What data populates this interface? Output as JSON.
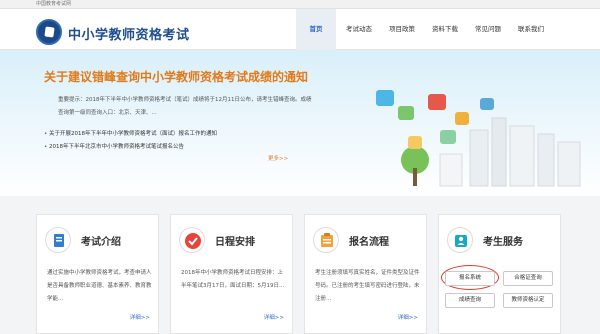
{
  "topbar": {
    "text": "中国教育考试网"
  },
  "header": {
    "site_title": "中小学教师资格考试",
    "nav": [
      "首页",
      "考试动态",
      "项目政策",
      "资料下载",
      "常见问题",
      "联系我们"
    ],
    "active_nav": "首页"
  },
  "banner": {
    "heading": "关于建议错峰查询中小学教师资格考试成绩的通知",
    "summary": "重要提示：2018年下半年中小学教师资格考试（笔试）成绩将于12月11日公布，请考生错峰查询。成绩查询第一级同查询入口：北京、天津、...",
    "links": [
      "关于开展2018年下半年中小学教师资格考试（面试）报名工作的通知",
      "2018年下半年北京市中小学教师资格考试笔试报名公告"
    ],
    "more": "更多>>"
  },
  "cards": [
    {
      "title": "考试介绍",
      "body": "通过实施中小学教师资格考试，考查申请人是否具备教师职业道德、基本素养、教育教学能...",
      "detail": "详细>>",
      "icon": "pen-document-icon"
    },
    {
      "title": "日程安排",
      "body": "2018年中小学教师资格考试日程安排：上半年笔试3月17日，面试日期：5月19日...",
      "detail": "详细>>",
      "icon": "check-circle-icon"
    },
    {
      "title": "报名流程",
      "body": "考生注册须填写真实姓名，证件类型及证件号码。已注册的考生填写密码进行登陆，未注册...",
      "detail": "详细>>",
      "icon": "clipboard-icon"
    },
    {
      "title": "考生服务",
      "icon": "person-icon",
      "buttons": [
        "报名系统",
        "合格证查询",
        "成绩查询",
        "教师资格认定"
      ]
    }
  ],
  "colors": {
    "brand_blue": "#1d4f90",
    "accent_orange": "#e07a1a",
    "highlight_red": "#e23a2a"
  }
}
